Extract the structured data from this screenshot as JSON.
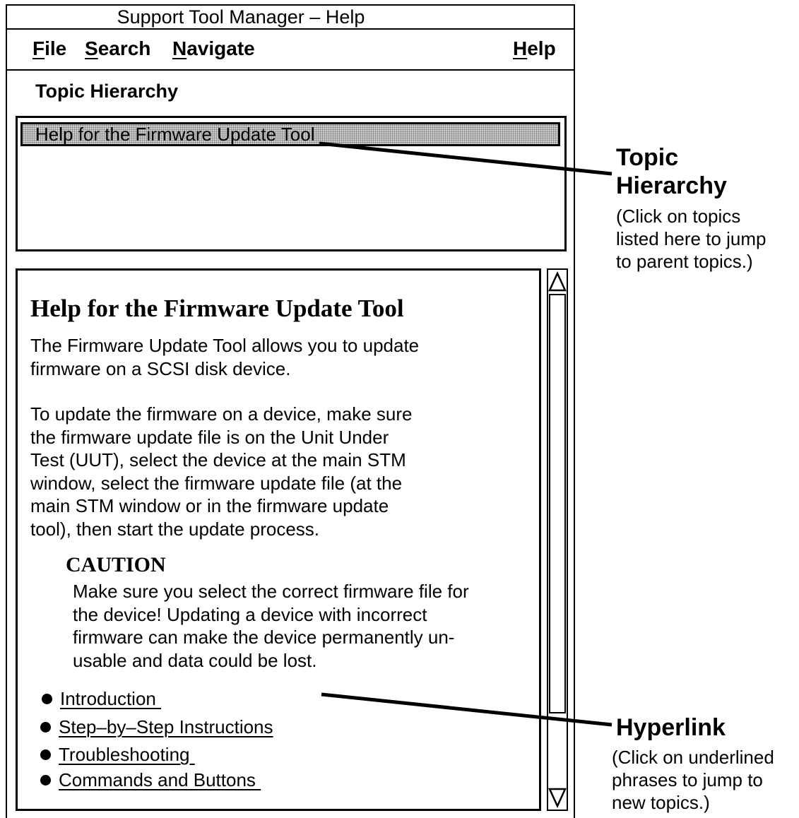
{
  "window": {
    "title": "Support Tool Manager – Help"
  },
  "menubar": {
    "items": [
      {
        "mnemonic": "F",
        "rest": "ile"
      },
      {
        "mnemonic": "S",
        "rest": "earch"
      },
      {
        "mnemonic": "N",
        "rest": "avigate"
      },
      {
        "mnemonic": "H",
        "rest": "elp"
      }
    ]
  },
  "topic_hierarchy": {
    "label": "Topic Hierarchy",
    "items": [
      "Help for the Firmware Update Tool"
    ]
  },
  "content": {
    "title": "Help for the Firmware Update Tool",
    "intro_lines": [
      "The Firmware Update Tool allows you to update",
      "firmware on a SCSI disk device."
    ],
    "instructions_lines": [
      "To update the firmware on a device, make sure",
      "the firmware update file is on the Unit Under",
      "Test (UUT), select the device at the main STM",
      "window, select the firmware update file (at the",
      "main STM window or in the firmware update",
      "tool), then start the update process."
    ],
    "caution": {
      "heading": "CAUTION",
      "lines": [
        "Make sure you select the correct firmware file for",
        "the device!  Updating a device with incorrect",
        "firmware can make the device permanently un-",
        "usable and data could be lost."
      ]
    },
    "links": [
      "Introduction ",
      "Step–by–Step Instructions",
      "Troubleshooting ",
      "Commands and Buttons "
    ]
  },
  "scrollbar": {
    "up_icon": "triangle-up-icon",
    "down_icon": "triangle-down-icon"
  },
  "annotations": {
    "topic_hierarchy": {
      "title_lines": [
        "Topic",
        "Hierarchy"
      ],
      "note_lines": [
        "(Click on topics",
        "listed here to jump",
        "to parent topics.)"
      ]
    },
    "hyperlink": {
      "title": "Hyperlink",
      "note_lines": [
        "(Click on underlined",
        "phrases to jump to",
        "new topics.)"
      ]
    }
  }
}
